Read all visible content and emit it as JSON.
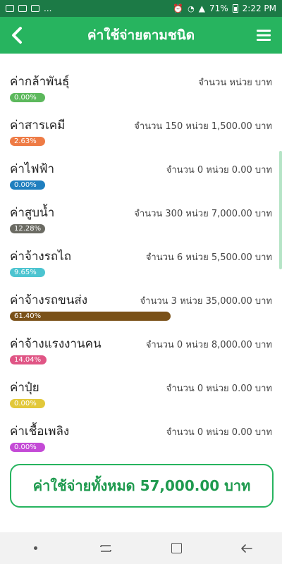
{
  "status_bar": {
    "battery_percent": "71%",
    "time": "2:22 PM",
    "overflow_indicator": "..."
  },
  "app_bar": {
    "title": "ค่าใช้จ่ายตามชนิด"
  },
  "items": [
    {
      "name": "ค่ากล้าพันธุ์",
      "summary": "จำนวน หน่วย บาท",
      "percent_label": "0.00%",
      "percent": 0.0,
      "color": "#5cb85c"
    },
    {
      "name": "ค่าสารเคมี",
      "summary": "จำนวน 150 หน่วย 1,500.00 บาท",
      "percent_label": "2.63%",
      "percent": 2.63,
      "color": "#ee7b45"
    },
    {
      "name": "ค่าไฟฟ้า",
      "summary": "จำนวน 0 หน่วย 0.00 บาท",
      "percent_label": "0.00%",
      "percent": 0.0,
      "color": "#1f7fbf"
    },
    {
      "name": "ค่าสูบน้ำ",
      "summary": "จำนวน 300 หน่วย 7,000.00 บาท",
      "percent_label": "12.28%",
      "percent": 12.28,
      "color": "#6b6b63"
    },
    {
      "name": "ค่าจ้างรถไถ",
      "summary": "จำนวน 6 หน่วย 5,500.00 บาท",
      "percent_label": "9.65%",
      "percent": 9.65,
      "color": "#4cc4d0"
    },
    {
      "name": "ค่าจ้างรถขนส่ง",
      "summary": "จำนวน 3 หน่วย 35,000.00 บาท",
      "percent_label": "61.40%",
      "percent": 61.4,
      "color": "#7a5118"
    },
    {
      "name": "ค่าจ้างแรงงานคน",
      "summary": "จำนวน 0 หน่วย 8,000.00 บาท",
      "percent_label": "14.04%",
      "percent": 14.04,
      "color": "#e05585"
    },
    {
      "name": "ค่าปุ๋ย",
      "summary": "จำนวน 0 หน่วย 0.00 บาท",
      "percent_label": "0.00%",
      "percent": 0.0,
      "color": "#e2c83a"
    },
    {
      "name": "ค่าเชื้อเพลิง",
      "summary": "จำนวน 0 หน่วย 0.00 บาท",
      "percent_label": "0.00%",
      "percent": 0.0,
      "color": "#c44ad6"
    }
  ],
  "total": {
    "label": "ค่าใช้จ่ายทั้งหมด 57,000.00 บาท"
  },
  "colors": {
    "header": "#27b45f",
    "status_bar": "#1c7a46",
    "total_text": "#1e9a4e"
  },
  "icons": {
    "back": "chevron-left-icon",
    "menu": "hamburger-menu-icon"
  }
}
